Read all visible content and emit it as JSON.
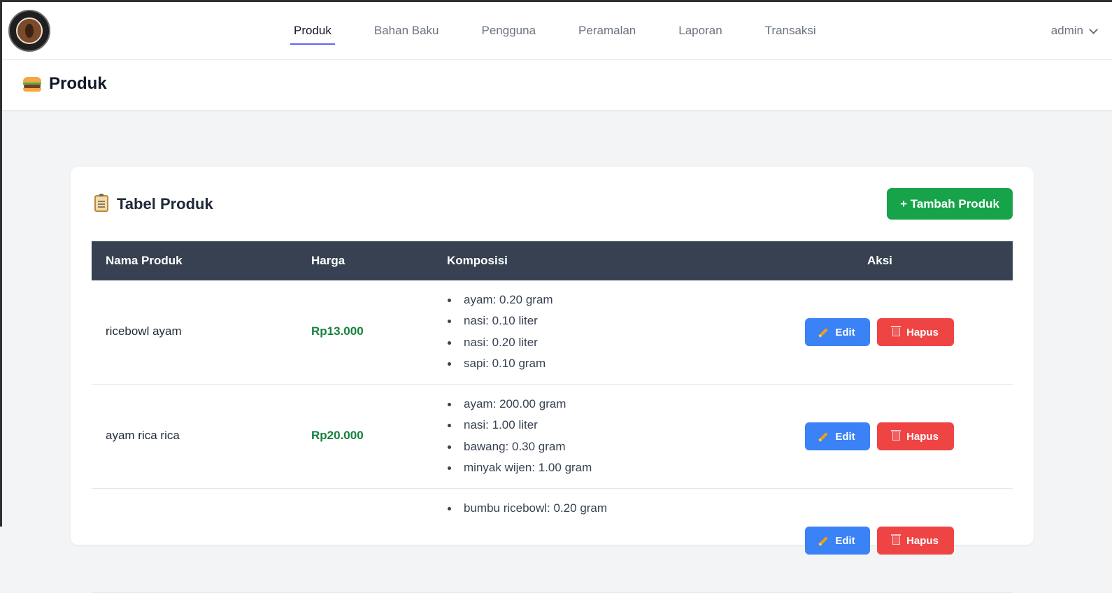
{
  "nav": {
    "links": [
      "Produk",
      "Bahan Baku",
      "Pengguna",
      "Peramalan",
      "Laporan",
      "Transaksi"
    ],
    "active": "Produk",
    "user": "admin"
  },
  "header": {
    "title": "Produk",
    "icon": "burger-icon"
  },
  "card": {
    "title": "Tabel Produk",
    "icon": "clipboard-icon",
    "add_button": "+ Tambah Produk"
  },
  "table": {
    "columns": [
      "Nama Produk",
      "Harga",
      "Komposisi",
      "Aksi"
    ],
    "edit_label": "Edit",
    "delete_label": "Hapus",
    "rows": [
      {
        "name": "ricebowl ayam",
        "price": "Rp13.000",
        "composition": [
          "ayam: 0.20 gram",
          "nasi: 0.10 liter",
          "nasi: 0.20 liter",
          "sapi: 0.10 gram"
        ]
      },
      {
        "name": "ayam rica rica",
        "price": "Rp20.000",
        "composition": [
          "ayam: 200.00 gram",
          "nasi: 1.00 liter",
          "bawang: 0.30 gram",
          "minyak wijen: 1.00 gram"
        ]
      },
      {
        "name": "",
        "price": "",
        "composition": [
          "bumbu ricebowl: 0.20 gram"
        ]
      }
    ]
  },
  "colors": {
    "accent": "#6366f1",
    "add_button": "#16a34a",
    "edit_button": "#3b82f6",
    "delete_button": "#ef4444",
    "table_header": "#374151",
    "price": "#15803d"
  }
}
